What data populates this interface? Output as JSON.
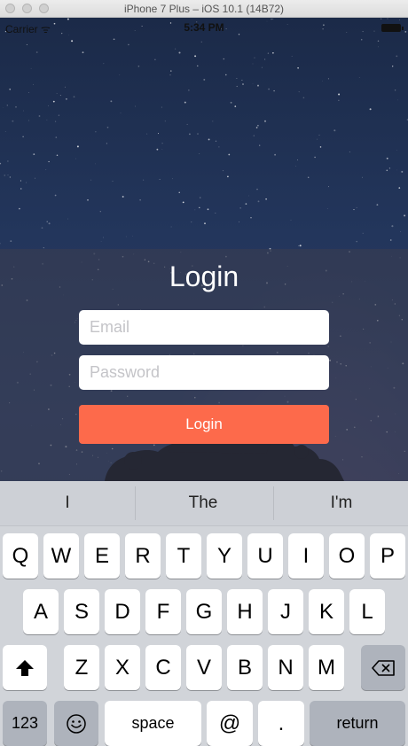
{
  "window": {
    "title": "iPhone 7 Plus – iOS 10.1 (14B72)"
  },
  "status_bar": {
    "carrier": "Carrier ᯤ",
    "time": "5:34 PM"
  },
  "login": {
    "title": "Login",
    "email_placeholder": "Email",
    "password_placeholder": "Password",
    "button_label": "Login"
  },
  "keyboard": {
    "suggestions": [
      "I",
      "The",
      "I'm"
    ],
    "row1": [
      "Q",
      "W",
      "E",
      "R",
      "T",
      "Y",
      "U",
      "I",
      "O",
      "P"
    ],
    "row2": [
      "A",
      "S",
      "D",
      "F",
      "G",
      "H",
      "J",
      "K",
      "L"
    ],
    "row3": [
      "Z",
      "X",
      "C",
      "V",
      "B",
      "N",
      "M"
    ],
    "bottom": {
      "numbers": "123",
      "space": "space",
      "at": "@",
      "dot": ".",
      "return": "return"
    },
    "icons": {
      "shift": "shift-icon",
      "delete": "delete-icon",
      "emoji": "emoji-icon"
    }
  }
}
